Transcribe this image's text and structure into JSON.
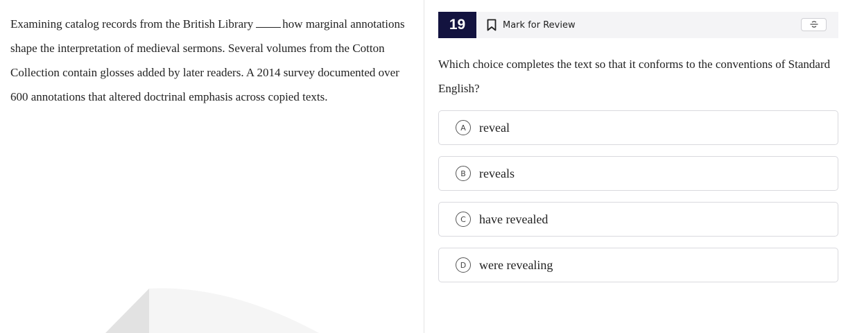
{
  "passage": {
    "before_blank": "Examining catalog records from the British Library",
    "after_blank": "how marginal annotations shape the interpretation of medieval sermons. Several volumes from the Cotton Collection contain glosses added by later readers. A 2014 survey documented over 600 annotations that altered doctrinal emphasis across copied texts."
  },
  "header": {
    "question_number": "19",
    "mark_for_review_label": "Mark for Review",
    "icons": {
      "bookmark": "bookmark-icon",
      "strikethrough_toggle": "strikethrough-icon"
    }
  },
  "question": {
    "prompt": "Which choice completes the text so that it conforms to the conventions of Standard English?"
  },
  "choices": [
    {
      "letter": "A",
      "text": "reveal"
    },
    {
      "letter": "B",
      "text": "reveals"
    },
    {
      "letter": "C",
      "text": "have revealed"
    },
    {
      "letter": "D",
      "text": "were revealing"
    }
  ],
  "colors": {
    "question_number_bg": "#13133f",
    "header_bg": "#f4f4f6",
    "choice_border": "#d9d9de"
  }
}
